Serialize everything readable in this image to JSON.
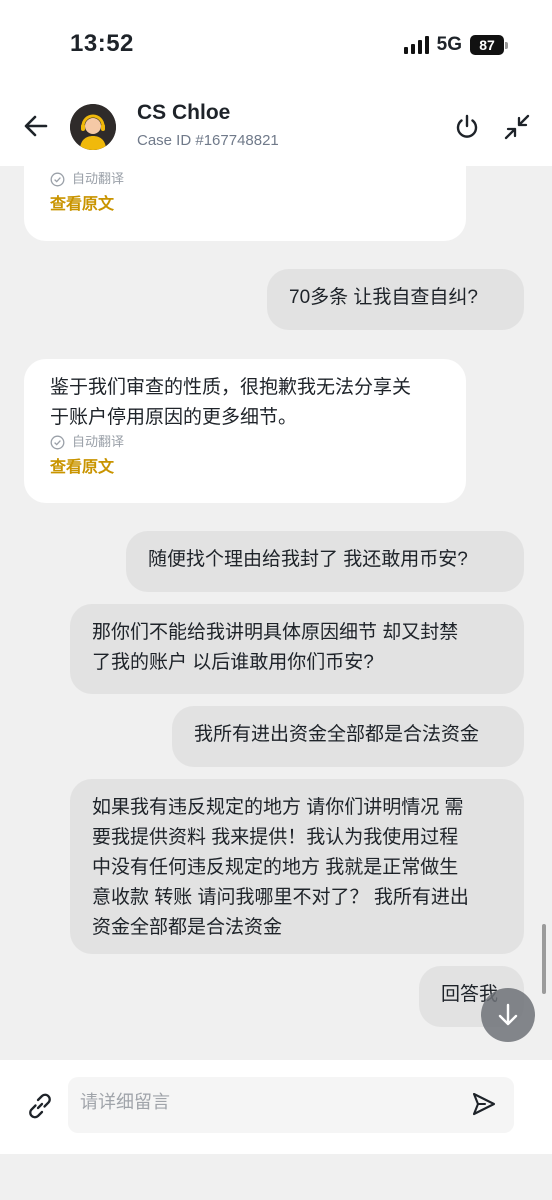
{
  "status_bar": {
    "time": "13:52",
    "network": "5G",
    "battery": "87"
  },
  "header": {
    "agent_name": "CS Chloe",
    "case_id": "Case ID #167748821"
  },
  "messages": {
    "m1": {
      "auto_translate": "自动翻译",
      "view_original": "查看原文"
    },
    "m2": {
      "text": "70多条 让我自查自纠?"
    },
    "m3": {
      "line1": "鉴于我们审查的性质，很抱歉我无法分享关",
      "line2": "于账户停用原因的更多细节。",
      "auto_translate": "自动翻译",
      "view_original": "查看原文"
    },
    "m4": {
      "text": "随便找个理由给我封了 我还敢用币安?"
    },
    "m5": {
      "line1": "那你们不能给我讲明具体原因细节 却又封禁",
      "line2": "了我的账户 以后谁敢用你们币安?"
    },
    "m6": {
      "text": "我所有进出资金全部都是合法资金"
    },
    "m7": {
      "line1": "如果我有违反规定的地方 请你们讲明情况 需",
      "line2": "要我提供资料 我来提供！我认为我使用过程",
      "line3": "中没有任何违反规定的地方 我就是正常做生",
      "line4": "意收款 转账 请问我哪里不对了？ 我所有进出",
      "line5": "资金全部都是合法资金"
    },
    "m8": {
      "text": "回答我"
    }
  },
  "input": {
    "placeholder": "请详细留言"
  },
  "icons": {
    "back": "arrow-left-icon",
    "power": "power-icon",
    "minimize": "minimize-icon",
    "attach": "link-icon",
    "send": "send-icon",
    "scroll_down": "arrow-down-icon",
    "translate": "check-circle-icon"
  },
  "colors": {
    "accent": "#C99400",
    "avatar_headset": "#F0B90B",
    "out_bubble": "#E2E2E2",
    "in_bubble": "#FFFFFF",
    "background": "#F0F0F0"
  }
}
